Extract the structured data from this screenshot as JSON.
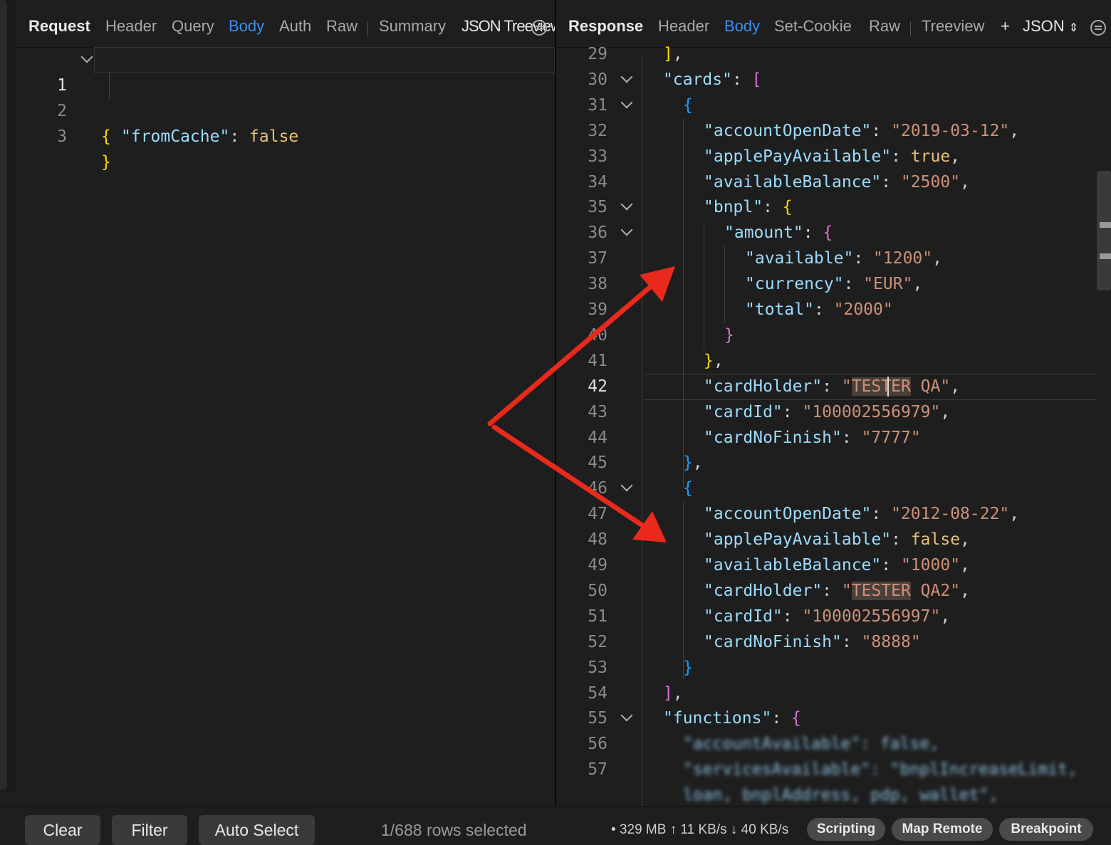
{
  "request": {
    "title": "Request",
    "tabs": [
      "Header",
      "Query",
      "Body",
      "Auth",
      "Raw",
      "Summary"
    ],
    "overlap_text": "JSON Treeview Co",
    "active_tab": "Body"
  },
  "response": {
    "title": "Response",
    "tabs": [
      "Header",
      "Body",
      "Set-Cookie",
      "Raw",
      "Treeview"
    ],
    "active_tab": "Body",
    "format_label": "JSON"
  },
  "request_code": [
    {
      "n": "1"
    },
    {
      "n": "2"
    },
    {
      "n": "3"
    }
  ],
  "request_tokens": {
    "brace_open": "{",
    "key": "\"fromCache\"",
    "value": "false",
    "brace_close": "}"
  },
  "response_code": {
    "line_numbers": [
      "29",
      "30",
      "31",
      "32",
      "33",
      "34",
      "35",
      "36",
      "37",
      "38",
      "39",
      "40",
      "41",
      "42",
      "43",
      "44",
      "45",
      "46",
      "47",
      "48",
      "49",
      "50",
      "51",
      "52",
      "53",
      "54",
      "55",
      "56",
      "57"
    ],
    "current_line": "42",
    "cards_key": "\"cards\"",
    "card1": {
      "accountOpenDate": "\"2019-03-12\"",
      "applePayAvailable": "true",
      "availableBalance": "\"2500\"",
      "bnpl_key": "\"bnpl\"",
      "amount_key": "\"amount\"",
      "available": "\"1200\"",
      "currency": "\"EUR\"",
      "total": "\"2000\"",
      "cardHolder_pre": "\"",
      "cardHolder_hl": "TESTER",
      "cardHolder_post": " QA\"",
      "cardId": "\"100002556979\"",
      "cardNoFinish": "\"7777\""
    },
    "card2": {
      "accountOpenDate": "\"2012-08-22\"",
      "applePayAvailable": "false",
      "availableBalance": "\"1000\"",
      "cardHolder_pre": "\"",
      "cardHolder_hl": "TESTER",
      "cardHolder_post": " QA2\"",
      "cardId": "\"100002556997\"",
      "cardNoFinish": "\"8888\""
    },
    "keys": {
      "accountOpenDate": "\"accountOpenDate\"",
      "applePayAvailable": "\"applePayAvailable\"",
      "availableBalance": "\"availableBalance\"",
      "available": "\"available\"",
      "currency": "\"currency\"",
      "total": "\"total\"",
      "cardHolder": "\"cardHolder\"",
      "cardId": "\"cardId\"",
      "cardNoFinish": "\"cardNoFinish\"",
      "functions": "\"functions\""
    },
    "blurred_56": "\"accountAvailable\": false,",
    "blurred_57": "\"servicesAvailable\": \"bnplIncreaseLimit,",
    "blurred_58": "loan, bnplAddress, pdp, wallet\","
  },
  "footer": {
    "clear": "Clear",
    "filter": "Filter",
    "auto_select": "Auto Select",
    "rows_selected": "1/688 rows selected",
    "stats": "• 329 MB ↑ 11 KB/s ↓ 40 KB/s",
    "scripting": "Scripting",
    "map_remote": "Map Remote",
    "breakpoint": "Breakpoint"
  },
  "colors": {
    "accent": "#3b8ef0",
    "arrow": "#e8291c"
  }
}
